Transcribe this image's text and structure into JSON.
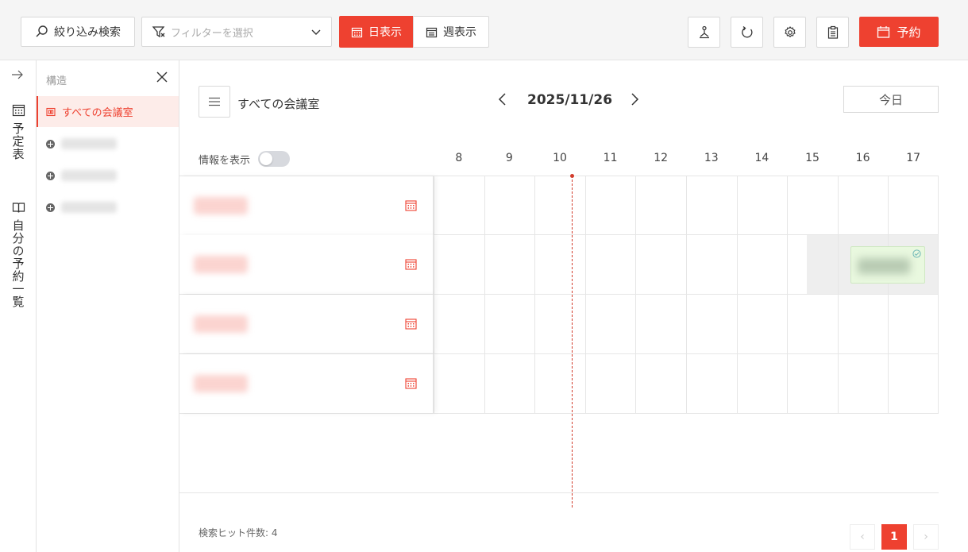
{
  "toolbar": {
    "search_label": "絞り込み検索",
    "filter_placeholder": "フィルターを選択",
    "view_day_label": "日表示",
    "view_week_label": "週表示",
    "book_label": "予約",
    "icons": [
      "search-icon",
      "filter-icon",
      "chevron-down-icon",
      "calendar-icon",
      "calendar-week-icon",
      "organization-icon",
      "refresh-icon",
      "settings-icon",
      "clipboard-icon",
      "calendar-add-icon"
    ]
  },
  "leftnav": {
    "items": [
      {
        "label": "予定表",
        "icon": "calendar-icon"
      },
      {
        "label": "自分の予約一覧",
        "icon": "book-icon"
      }
    ]
  },
  "structure": {
    "title": "構造",
    "active_item": "すべての会議室"
  },
  "main": {
    "room_title": "すべての会議室",
    "date": "2025/11/26",
    "today_label": "今日",
    "info_label": "情報を表示",
    "info_toggle_on": false,
    "hours": [
      "8",
      "9",
      "10",
      "11",
      "12",
      "13",
      "14",
      "15",
      "16",
      "17"
    ],
    "hits_label": "検索ヒット件数: 4",
    "page": "1",
    "prev_label": "‹",
    "next_label": "›"
  },
  "colors": {
    "accent": "#ee4130",
    "booking_bg": "#e9f8df",
    "now_line": "#d23c2c"
  }
}
